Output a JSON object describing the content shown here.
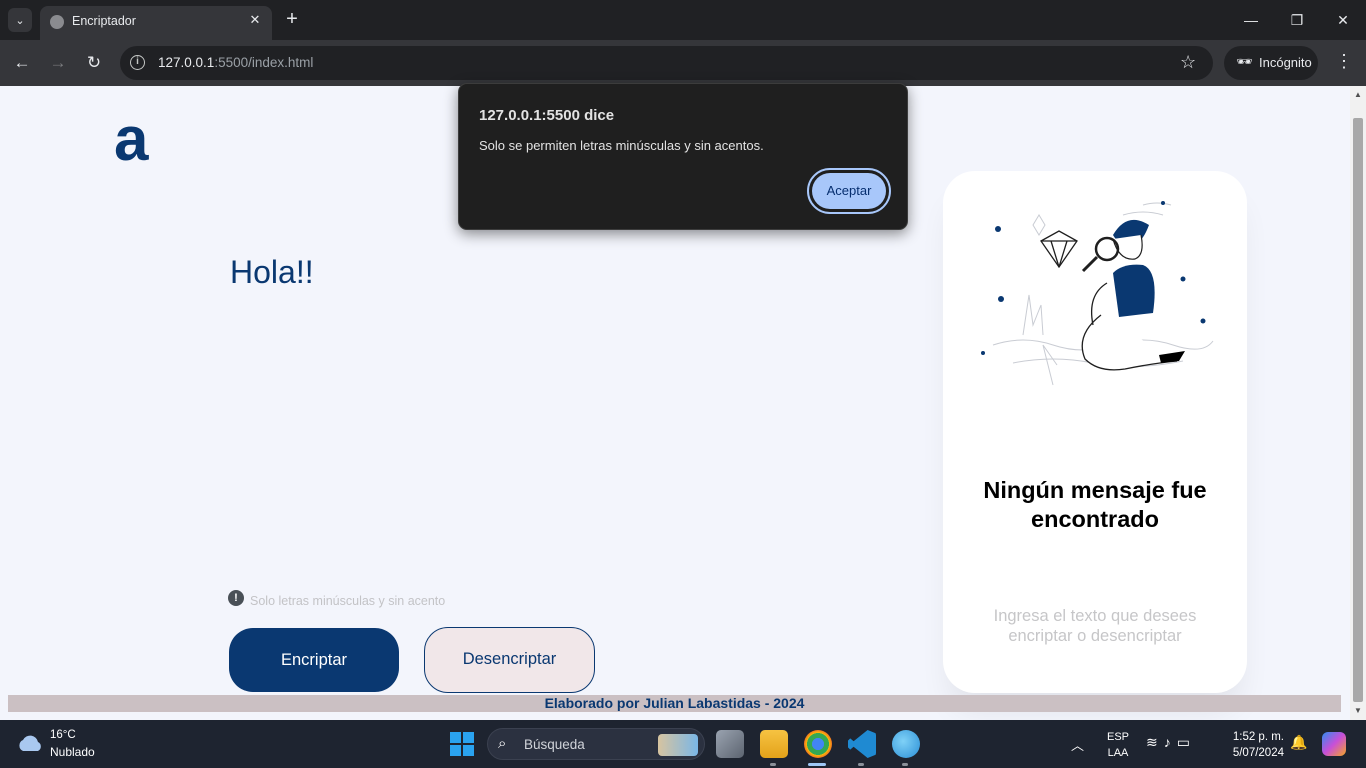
{
  "browser": {
    "tab_title": "Encriptador",
    "url_host": "127.0.0.1",
    "url_rest": ":5500/index.html",
    "incognito_label": "Incógnito"
  },
  "page": {
    "logo": "a",
    "input_text": "Hola!!",
    "hint_icon": "!",
    "hint": "Solo letras minúsculas y sin acento",
    "encrypt_label": "Encriptar",
    "decrypt_label": "Desencriptar",
    "panel_heading": "Ningún mensaje fue encontrado",
    "panel_text": "Ingresa el texto que desees encriptar o desencriptar",
    "footer": "Elaborado por Julian Labastidas - 2024",
    "colors": {
      "primary": "#0a3871",
      "background": "#f3f5fc",
      "secondary_button": "#f1e7e9"
    }
  },
  "dialog": {
    "title": "127.0.0.1:5500 dice",
    "message": "Solo se permiten letras minúsculas y sin acentos.",
    "ok_label": "Aceptar"
  },
  "taskbar": {
    "temperature": "16°C",
    "condition": "Nublado",
    "search_placeholder": "Búsqueda",
    "lang1": "ESP",
    "lang2": "LAA",
    "time": "1:52 p. m.",
    "date": "5/07/2024",
    "icons": [
      "windows-start-icon",
      "search-icon",
      "task-view-icon",
      "file-explorer-icon",
      "chrome-icon",
      "vscode-icon",
      "paint-icon"
    ]
  }
}
